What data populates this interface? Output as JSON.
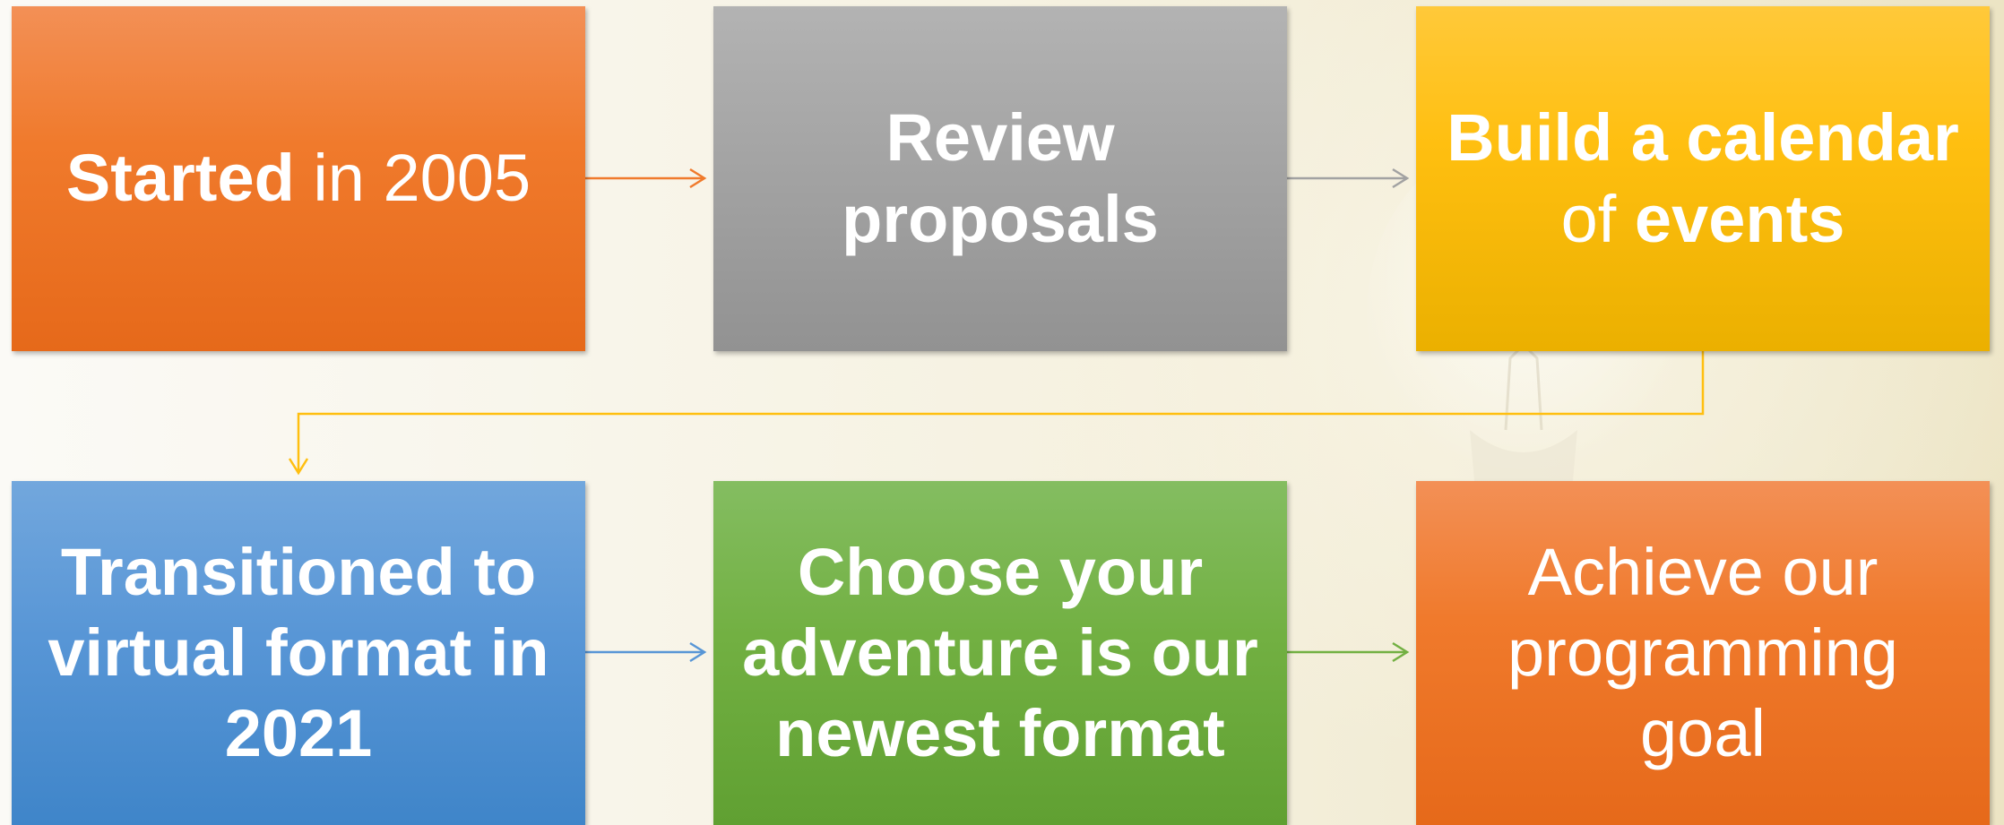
{
  "nodes": [
    {
      "id": "box1",
      "parts": [
        {
          "text": "Started",
          "bold": true
        },
        {
          "text": " in 2005",
          "bold": false
        }
      ],
      "color": "#f07a2c"
    },
    {
      "id": "box2",
      "parts": [
        {
          "text": "Review proposals",
          "bold": true
        }
      ],
      "color": "#a2a2a2"
    },
    {
      "id": "box3",
      "parts": [
        {
          "text": "Build a calendar",
          "bold": true
        },
        {
          "text": " of ",
          "bold": false
        },
        {
          "text": "events",
          "bold": true
        }
      ],
      "color": "#ffbf10"
    },
    {
      "id": "box4",
      "parts": [
        {
          "text": "Transitioned to virtual format in 2021",
          "bold": true
        }
      ],
      "color": "#5896d6"
    },
    {
      "id": "box5",
      "parts": [
        {
          "text": "Choose your adventure is our newest format",
          "bold": true
        }
      ],
      "color": "#72b042"
    },
    {
      "id": "box6",
      "parts": [
        {
          "text": "Achieve our programming goal",
          "bold": false
        }
      ],
      "color": "#f07a2c"
    }
  ],
  "connector_colors": {
    "box1_to_box2": "#f07a2c",
    "box2_to_box3": "#a2a2a2",
    "box3_to_box4": "#ffbf10",
    "box4_to_box5": "#5896d6",
    "box5_to_box6": "#72b042"
  }
}
